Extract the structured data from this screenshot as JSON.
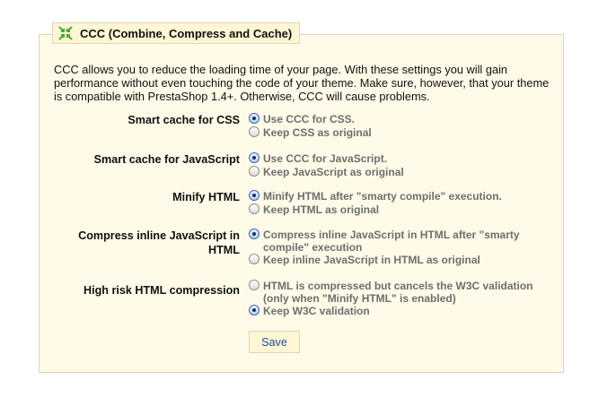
{
  "section": {
    "title": "CCC (Combine, Compress and Cache)",
    "icon": "compress-arrows-icon"
  },
  "intro": "CCC allows you to reduce the loading time of your page. With these settings you will gain performance without even touching the code of your theme. Make sure, however, that your theme is compatible with PrestaShop 1.4+. Otherwise, CCC will cause problems.",
  "settings": [
    {
      "label": "Smart cache for CSS",
      "options": [
        {
          "text": "Use CCC for CSS.",
          "selected": true
        },
        {
          "text": "Keep CSS as original",
          "selected": false
        }
      ]
    },
    {
      "label": "Smart cache for JavaScript",
      "options": [
        {
          "text": "Use CCC for JavaScript.",
          "selected": true
        },
        {
          "text": "Keep JavaScript as original",
          "selected": false
        }
      ]
    },
    {
      "label": "Minify HTML",
      "options": [
        {
          "text": "Minify HTML after \"smarty compile\" execution.",
          "selected": true
        },
        {
          "text": "Keep HTML as original",
          "selected": false
        }
      ]
    },
    {
      "label": "Compress inline JavaScript in HTML",
      "options": [
        {
          "text": "Compress inline JavaScript in HTML after \"smarty compile\" execution",
          "selected": true
        },
        {
          "text": "Keep inline JavaScript in HTML as original",
          "selected": false
        }
      ]
    },
    {
      "label": "High risk HTML compression",
      "options": [
        {
          "text": "HTML is compressed but cancels the W3C validation (only when \"Minify HTML\" is enabled)",
          "selected": false
        },
        {
          "text": "Keep W3C validation",
          "selected": true
        }
      ]
    }
  ],
  "save_label": "Save",
  "colors": {
    "panel_bg": "#fffbe8",
    "border": "#dfd5b3",
    "option_text": "#6e6e6e",
    "save_text": "#1b4ea0"
  }
}
